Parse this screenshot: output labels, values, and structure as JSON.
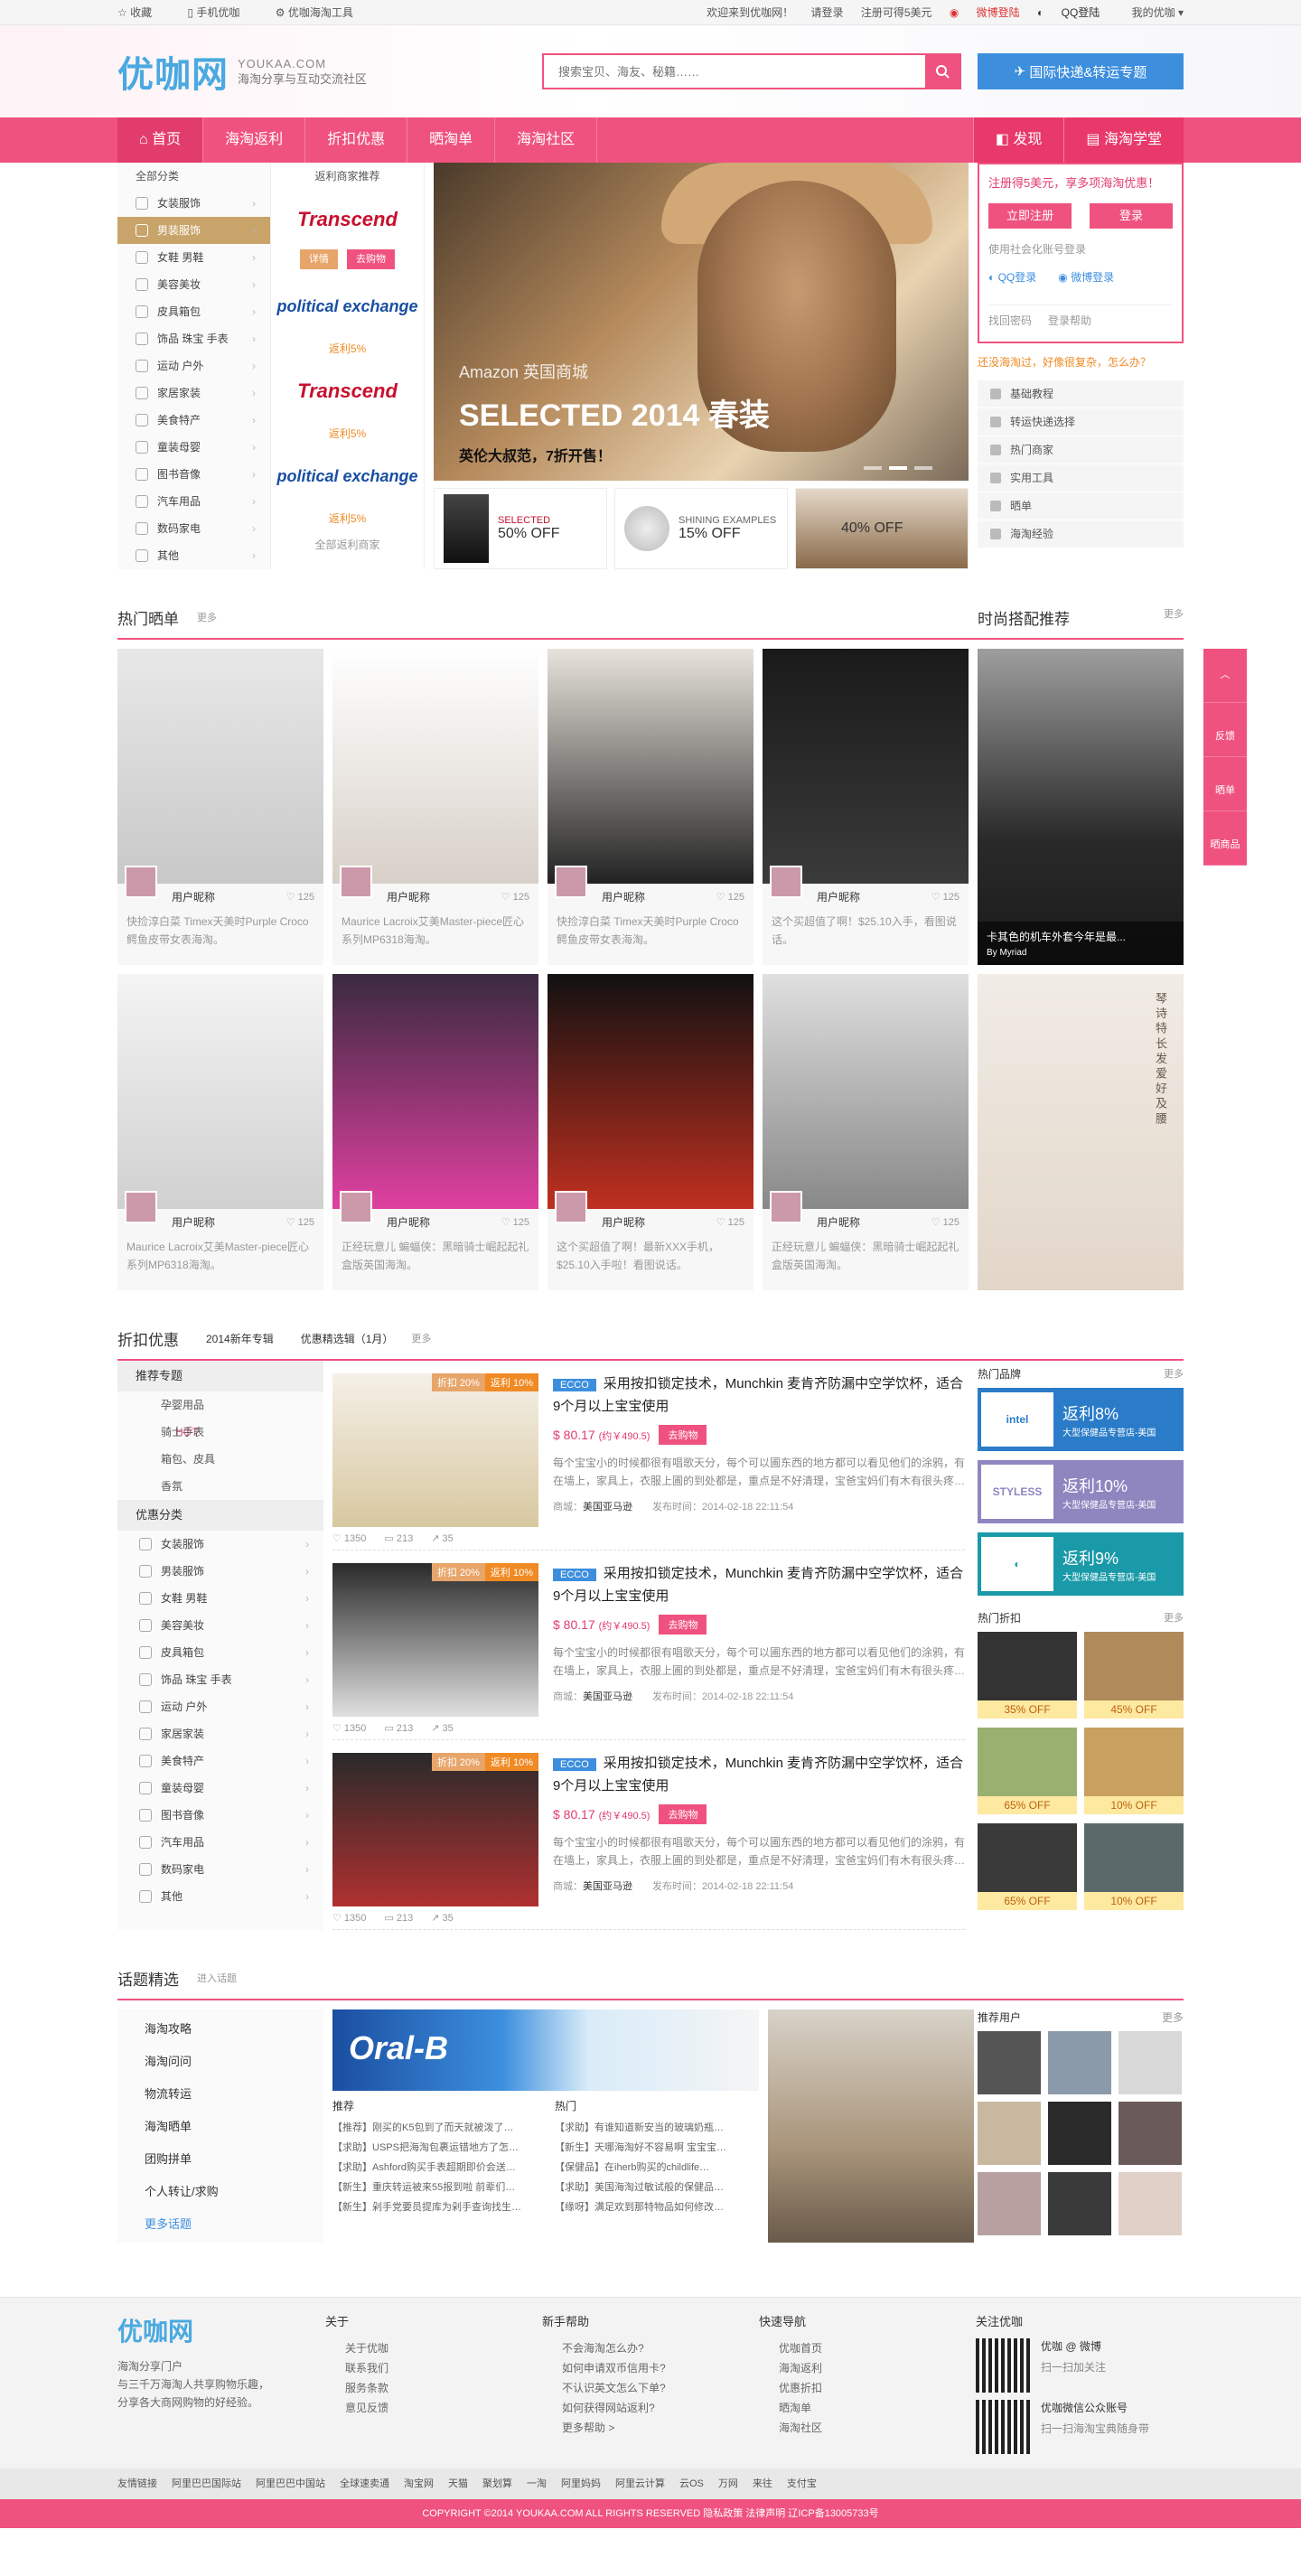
{
  "topbar": {
    "left": [
      "收藏",
      "手机优咖",
      "优咖海淘工具"
    ],
    "right": [
      "欢迎来到优咖网！",
      "请登录",
      "注册可得5美元",
      "微博登陆",
      "QQ登陆",
      "我的优咖"
    ]
  },
  "header": {
    "logo": "优咖网",
    "logo_en": "YOUKAA.COM",
    "logo_cn": "海淘分享与互动交流社区",
    "search_placeholder": "搜索宝贝、海友、秘籍……",
    "express_btn": "国际快递&转运专题"
  },
  "nav": {
    "items": [
      "首页",
      "海淘返利",
      "折扣优惠",
      "晒淘单",
      "海淘社区"
    ],
    "right": [
      "发现",
      "海淘学堂"
    ]
  },
  "categories": {
    "title": "全部分类",
    "items": [
      "女装服饰",
      "男装服饰",
      "女鞋 男鞋",
      "美容美妆",
      "皮具箱包",
      "饰品 珠宝 手表",
      "运动 户外",
      "家居家装",
      "美食特产",
      "童装母婴",
      "图书音像",
      "汽车用品",
      "数码家电",
      "其他"
    ]
  },
  "merchant": {
    "title": "返利商家推荐",
    "logos": [
      "Transcend",
      "political exchange",
      "Transcend",
      "political exchange"
    ],
    "rebates": [
      "返利5%",
      "返利5%",
      "返利5%"
    ],
    "detail": "详情",
    "buy": "去购物",
    "all": "全部返利商家"
  },
  "banner": {
    "t1": "Amazon 英国商城",
    "t2": "SELECTED 2014 春装",
    "t3": "英伦大叔范，7折开售！"
  },
  "promos": [
    {
      "brand": "SELECTED",
      "text": "50% OFF"
    },
    {
      "brand": "SHINING EXAMPLES",
      "text": "15% OFF"
    },
    {
      "brand": "",
      "text": "40% OFF"
    }
  ],
  "login": {
    "tip": "注册得5美元，享多项海淘优惠！",
    "register": "立即注册",
    "login": "登录",
    "social": "使用社会化账号登录",
    "qq": "QQ登录",
    "weibo": "微博登录",
    "forgot": "找回密码",
    "help": "登录帮助"
  },
  "question": "还没海淘过，好像很复杂，怎么办？",
  "guide": [
    "基础教程",
    "转运快递选择",
    "热门商家",
    "实用工具",
    "晒单",
    "海淘经验"
  ],
  "hot": {
    "title": "热门晒单",
    "more": "更多",
    "cards": [
      {
        "user": "用户昵称",
        "likes": "125",
        "desc": "快捡淳白菜 Timex天美时Purple Croco鳄鱼皮带女表海淘。"
      },
      {
        "user": "用户昵称",
        "likes": "125",
        "desc": "Maurice Lacroix艾美Master-piece匠心系列MP6318海淘。"
      },
      {
        "user": "用户昵称",
        "likes": "125",
        "desc": "快捡淳白菜 Timex天美时Purple Croco鳄鱼皮带女表海淘。"
      },
      {
        "user": "用户昵称",
        "likes": "125",
        "desc": "这个买超值了啊！$25.10入手，看图说话。"
      },
      {
        "user": "用户昵称",
        "likes": "125",
        "desc": "Maurice Lacroix艾美Master-piece匠心系列MP6318海淘。"
      },
      {
        "user": "用户昵称",
        "likes": "125",
        "desc": "正经玩意儿 蝙蝠侠：黑暗骑士崛起起礼盒版英国海淘。"
      },
      {
        "user": "用户昵称",
        "likes": "125",
        "desc": "这个买超值了啊！最新XXX手机，$25.10入手啦！看图说话。"
      },
      {
        "user": "用户昵称",
        "likes": "125",
        "desc": "正经玩意儿 蝙蝠侠：黑暗骑士崛起起礼盒版英国海淘。"
      }
    ]
  },
  "fashion": {
    "title": "时尚搭配推荐",
    "more": "更多",
    "caption": "卡其色的机车外套今年是最...",
    "by": "By Myriad",
    "poem": "琴 诗 特 长 发 爱 好 及 腰"
  },
  "floatbar": [
    "反馈",
    "晒单",
    "晒商品"
  ],
  "deals": {
    "title": "折扣优惠",
    "tabs": [
      "2014新年专辑",
      "优惠精选辑（1月）",
      "更多"
    ],
    "cat_h1": "推荐专题",
    "subs": [
      "孕婴用品",
      "骑士手表",
      "箱包、皮具",
      "香氛"
    ],
    "hot_label": "HOT",
    "cat_h2": "优惠分类",
    "items": [
      {
        "off": "折扣 20%",
        "rebate": "返利 10%",
        "brand": "ECCO",
        "title": "采用按扣锁定技术，Munchkin 麦肯齐防漏中空学饮杯，适合9个月以上宝宝使用",
        "price": "$ 80.17",
        "cny": "(约￥490.5)",
        "go": "去购物",
        "text": "每个宝宝小的时候都很有唱歌天分，每个可以圃东西的地方都可以看见他们的涂鸦，有在墙上，家具上，衣服上圃的到处都是，重点是不好清理，宝爸宝妈们有木有很头疼…",
        "shop": "美国亚马逊",
        "date": "2014-02-18 22:11:54",
        "views": "1350",
        "comments": "213",
        "shares": "35"
      },
      {
        "off": "折扣 20%",
        "rebate": "返利 10%",
        "brand": "ECCO",
        "title": "采用按扣锁定技术，Munchkin 麦肯齐防漏中空学饮杯，适合9个月以上宝宝使用",
        "price": "$ 80.17",
        "cny": "(约￥490.5)",
        "go": "去购物",
        "text": "每个宝宝小的时候都很有唱歌天分，每个可以圃东西的地方都可以看见他们的涂鸦，有在墙上，家具上，衣服上圃的到处都是，重点是不好清理，宝爸宝妈们有木有很头疼…",
        "shop": "美国亚马逊",
        "date": "2014-02-18 22:11:54",
        "views": "1350",
        "comments": "213",
        "shares": "35"
      },
      {
        "off": "折扣 20%",
        "rebate": "返利 10%",
        "brand": "ECCO",
        "title": "采用按扣锁定技术，Munchkin 麦肯齐防漏中空学饮杯，适合9个月以上宝宝使用",
        "price": "$ 80.17",
        "cny": "(约￥490.5)",
        "go": "去购物",
        "text": "每个宝宝小的时候都很有唱歌天分，每个可以圃东西的地方都可以看见他们的涂鸦，有在墙上，家具上，衣服上圃的到处都是，重点是不好清理，宝爸宝妈们有木有很头疼…",
        "shop": "美国亚马逊",
        "date": "2014-02-18 22:11:54",
        "views": "1350",
        "comments": "213",
        "shares": "35"
      }
    ],
    "labels": {
      "shop": "商城：",
      "date": "发布时间："
    }
  },
  "brands": {
    "title": "热门品牌",
    "more": "更多",
    "items": [
      {
        "logo": "intel",
        "rebate": "返利8%",
        "sub": "大型保健品专营店-美国",
        "color": "#2a7cc8"
      },
      {
        "logo": "STYLESS",
        "rebate": "返利10%",
        "sub": "大型保健品专营店-美国",
        "color": "#8f86c0"
      },
      {
        "logo": "◐",
        "rebate": "返利9%",
        "sub": "大型保健品专营店-美国",
        "color": "#1a9aa8"
      }
    ]
  },
  "hot_deals": {
    "title": "热门折扣",
    "more": "更多",
    "items": [
      "35% OFF",
      "45% OFF",
      "65% OFF",
      "10% OFF",
      "65% OFF",
      "10% OFF"
    ]
  },
  "topics": {
    "title": "话题精选",
    "enter": "进入话题",
    "nav": [
      "海淘攻略",
      "海淘问问",
      "物流转运",
      "海淘晒单",
      "团购拼单",
      "个人转让/求购",
      "更多话题"
    ],
    "brand": "Oral-B",
    "col1": "推荐",
    "col2": "热门",
    "lines1": [
      "【推荐】刚买的K5包到了而天就被泼了…",
      "【求助】USPS把海淘包裹运错地方了怎…",
      "【求助】Ashford购买手表超期即价会送…",
      "【新生】重庆转运被来55报到啦 前辈们…",
      "【新生】剁手党要员提库为剁手查询找生…"
    ],
    "lines2": [
      "【求助】有谁知道新安当的玻璃奶瓶…",
      "【新生】天哪海淘好不容易啊 宝宝宝…",
      "【保健品】在iherb购买的childlife…",
      "【求助】美国海淘过敏试般的保健品…",
      "【缘呀】满足欢到那特物品如何修改…"
    ]
  },
  "users": {
    "title": "推荐用户",
    "more": "更多"
  },
  "footer": {
    "logo": "优咖网",
    "desc": [
      "海淘分享门户",
      "与三千万海淘人共享购物乐趣，",
      "分享各大商网购物的好经验。"
    ],
    "cols": [
      {
        "h": "关于",
        "items": [
          "关于优咖",
          "联系我们",
          "服务条款",
          "意见反馈"
        ]
      },
      {
        "h": "新手帮助",
        "items": [
          "不会海淘怎么办?",
          "如何申请双币信用卡?",
          "不认识英文怎么下单?",
          "如何获得网站返利?",
          "更多帮助 >"
        ]
      },
      {
        "h": "快速导航",
        "items": [
          "优咖首页",
          "海淘返利",
          "优惠折扣",
          "晒淘单",
          "海淘社区"
        ]
      }
    ],
    "follow": "关注优咖",
    "qr1": [
      "优咖 @ 微博",
      "扫一扫加关注"
    ],
    "qr2": [
      "优咖微信公众账号",
      "扫一扫海淘宝典随身带"
    ],
    "links_label": "友情链接",
    "links": [
      "阿里巴巴国际站",
      "阿里巴巴中国站",
      "全球速卖通",
      "淘宝网",
      "天猫",
      "聚划算",
      "一淘",
      "阿里妈妈",
      "阿里云计算",
      "云OS",
      "万网",
      "来往",
      "支付宝"
    ],
    "copyright": "COPYRIGHT ©2014 YOUKAA.COM ALL RIGHTS RESERVED  隐私政策  法律声明  辽ICP备13005733号"
  }
}
